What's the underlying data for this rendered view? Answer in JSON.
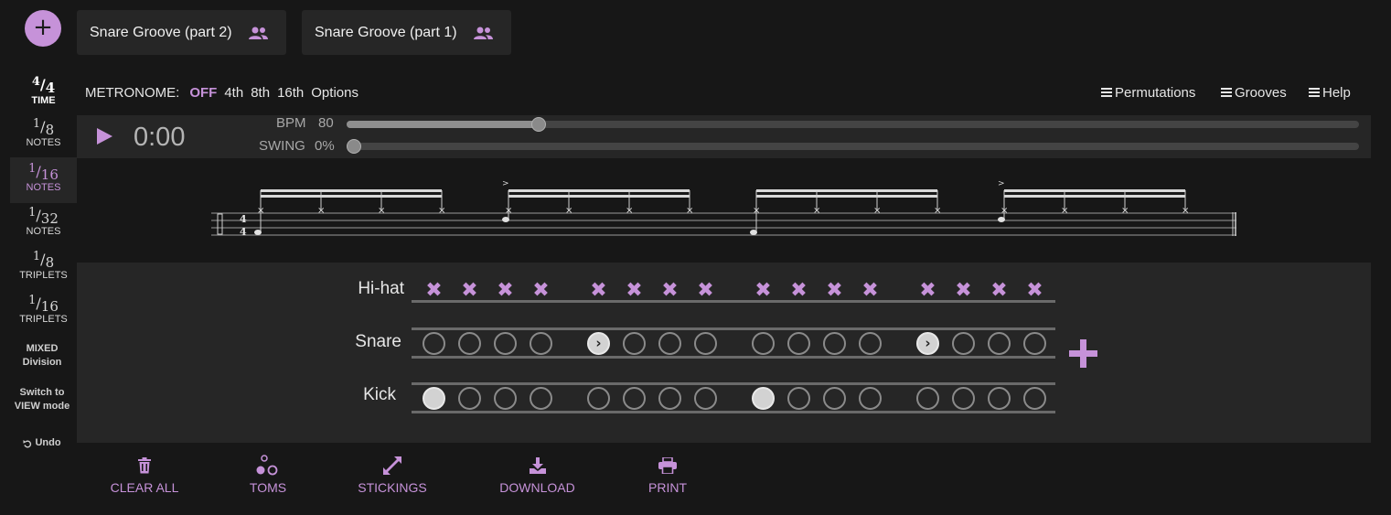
{
  "top": {
    "add_label": "+",
    "tabs": [
      {
        "label": "Snare Groove (part 2)"
      },
      {
        "label": "Snare Groove (part 1)"
      }
    ]
  },
  "sidebar": {
    "time": {
      "num": "4",
      "den": "4",
      "label": "TIME"
    },
    "notes": [
      {
        "num": "1",
        "den": "8",
        "label": "NOTES"
      },
      {
        "num": "1",
        "den": "16",
        "label": "NOTES"
      },
      {
        "num": "1",
        "den": "32",
        "label": "NOTES"
      },
      {
        "num": "1",
        "den": "8",
        "label": "TRIPLETS"
      },
      {
        "num": "1",
        "den": "16",
        "label": "TRIPLETS"
      }
    ],
    "mixed_line1": "MIXED",
    "mixed_line2": "Division",
    "switch_line1": "Switch to",
    "switch_line2": "VIEW mode",
    "undo": "Undo"
  },
  "metronome": {
    "label": "METRONOME:",
    "off": "OFF",
    "options": [
      "4th",
      "8th",
      "16th",
      "Options"
    ]
  },
  "menu": {
    "permutations": "Permutations",
    "grooves": "Grooves",
    "help": "Help"
  },
  "player": {
    "time": "0:00",
    "bpm_label": "BPM",
    "bpm_value": "80",
    "swing_label": "SWING",
    "swing_value": "0%",
    "bpm_fraction": 0.19,
    "swing_fraction": 0.0
  },
  "grid": {
    "hihat_label": "Hi-hat",
    "snare_label": "Snare",
    "kick_label": "Kick",
    "hihat": [
      1,
      1,
      1,
      1,
      1,
      1,
      1,
      1,
      1,
      1,
      1,
      1,
      1,
      1,
      1,
      1
    ],
    "snare": [
      0,
      0,
      0,
      0,
      2,
      0,
      0,
      0,
      0,
      0,
      0,
      0,
      2,
      0,
      0,
      0
    ],
    "kick": [
      1,
      0,
      0,
      0,
      0,
      0,
      0,
      0,
      1,
      0,
      0,
      0,
      0,
      0,
      0,
      0
    ]
  },
  "notation": {
    "time_sig_top": "4",
    "time_sig_bottom": "4",
    "accent_mark": ">"
  },
  "toolbar": {
    "clear_all": "CLEAR ALL",
    "toms": "TOMS",
    "stickings": "STICKINGS",
    "download": "DOWNLOAD",
    "print": "PRINT"
  },
  "colors": {
    "accent": "#c692d9",
    "background": "#171717",
    "panel": "#262626"
  }
}
